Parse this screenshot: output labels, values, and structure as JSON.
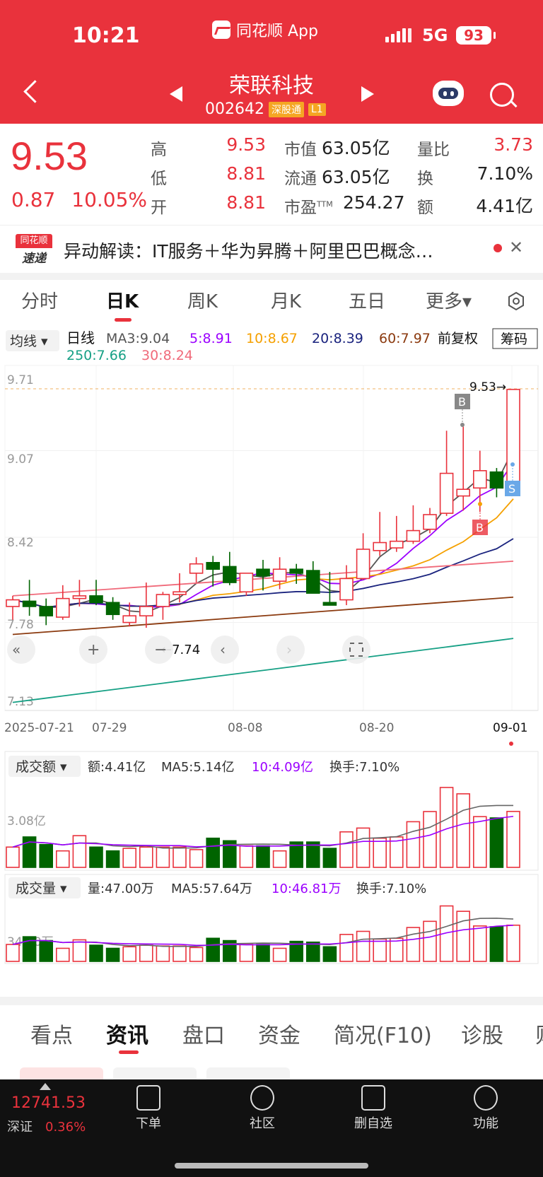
{
  "status": {
    "time": "10:21",
    "app": "同花顺 App",
    "network": "5G",
    "battery": "93"
  },
  "header": {
    "name": "荣联科技",
    "code": "002642",
    "badge1": "深股通",
    "badge2": "L1"
  },
  "quote": {
    "price": "9.53",
    "change": "0.87",
    "change_pct": "10.05%",
    "high_label": "高",
    "high": "9.53",
    "low_label": "低",
    "low": "8.81",
    "open_label": "开",
    "open": "8.81",
    "mcap_label": "市值",
    "mcap": "63.05亿",
    "float_label": "流通",
    "float": "63.05亿",
    "pe_label": "市盈",
    "pe_sup": "TTM",
    "pe": "254.27",
    "vr_label": "量比",
    "vr": "3.73",
    "turnover_label": "换",
    "turnover": "7.10%",
    "amount_label": "额",
    "amount": "4.41亿"
  },
  "news": {
    "logo_top": "同花顺",
    "logo_bottom": "速递",
    "text": "异动解读：IT服务＋华为昇腾＋阿里巴巴概念…",
    "close": "✕"
  },
  "tabs": [
    "分时",
    "日K",
    "周K",
    "月K",
    "五日",
    "更多▾"
  ],
  "chart": {
    "ma_button": "均线 ▾",
    "series_label": "日线",
    "ma3": "MA3:9.04",
    "ma5": "5:8.91",
    "ma10": "10:8.67",
    "ma20": "20:8.39",
    "ma60": "60:7.97",
    "ma250": "250:7.66",
    "ma30": "30:8.24",
    "adjust": "前复权",
    "chip_button": "筹码",
    "y_labels": [
      "9.71",
      "9.07",
      "8.42",
      "7.78",
      "7.13"
    ],
    "x_labels": [
      "2025-07-21",
      "07-29",
      "08-08",
      "08-20",
      "09-01"
    ],
    "max_label": "9.53→",
    "min_label": "←7.74",
    "marker_b": "B",
    "marker_s": "S",
    "colors": {
      "up": "#e9323c",
      "down": "#006400",
      "ma3": "#555555",
      "ma5": "#9b00ff",
      "ma10": "#f5a000",
      "ma20": "#1a237e",
      "ma60": "#8b3a0f",
      "ma250": "#16a085",
      "ma30": "#f06a7a"
    }
  },
  "chart_data": {
    "type": "candlestick",
    "x": [
      "07-21",
      "07-22",
      "07-23",
      "07-24",
      "07-25",
      "07-28",
      "07-29",
      "07-30",
      "07-31",
      "08-01",
      "08-04",
      "08-05",
      "08-06",
      "08-07",
      "08-08",
      "08-11",
      "08-12",
      "08-13",
      "08-14",
      "08-15",
      "08-18",
      "08-19",
      "08-20",
      "08-21",
      "08-22",
      "08-25",
      "08-26",
      "08-27",
      "08-28",
      "08-29",
      "09-01"
    ],
    "open": [
      7.9,
      7.94,
      7.9,
      7.82,
      7.96,
      7.98,
      7.93,
      7.78,
      7.83,
      7.9,
      7.99,
      8.15,
      8.23,
      8.2,
      8.01,
      8.18,
      8.09,
      8.18,
      8.17,
      7.93,
      7.95,
      8.11,
      8.32,
      8.34,
      8.39,
      8.48,
      8.6,
      8.73,
      8.79,
      8.91,
      8.81
    ],
    "high": [
      7.98,
      8.1,
      7.96,
      8.06,
      8.1,
      8.1,
      7.97,
      7.93,
      8.08,
      8.01,
      8.15,
      8.27,
      8.28,
      8.31,
      8.12,
      8.25,
      8.27,
      8.22,
      8.24,
      8.16,
      8.21,
      8.45,
      8.61,
      8.58,
      8.66,
      8.64,
      9.22,
      9.25,
      9.07,
      8.94,
      9.53
    ],
    "low": [
      7.8,
      7.83,
      7.76,
      7.8,
      7.9,
      7.91,
      7.8,
      7.75,
      7.74,
      7.8,
      7.93,
      8.08,
      8.05,
      8.06,
      7.98,
      8.02,
      8.03,
      8.07,
      8.09,
      7.92,
      7.91,
      8.1,
      8.28,
      8.31,
      8.37,
      8.45,
      8.58,
      8.62,
      8.61,
      8.72,
      8.81
    ],
    "close": [
      7.95,
      7.9,
      7.83,
      7.96,
      7.98,
      7.93,
      7.84,
      7.83,
      7.9,
      7.99,
      8.01,
      8.22,
      8.18,
      8.08,
      8.15,
      8.13,
      8.18,
      8.15,
      8.0,
      7.91,
      8.11,
      8.33,
      8.38,
      8.39,
      8.47,
      8.59,
      8.9,
      8.78,
      8.92,
      8.79,
      9.53
    ],
    "amount_yi": [
      1.6,
      2.4,
      1.8,
      1.3,
      2.5,
      1.6,
      1.3,
      1.5,
      1.6,
      1.6,
      1.6,
      1.4,
      2.3,
      2.1,
      1.7,
      1.7,
      1.3,
      2.0,
      2.0,
      1.5,
      2.8,
      3.1,
      2.3,
      2.4,
      3.6,
      4.4,
      6.3,
      5.8,
      4.0,
      3.9,
      4.41
    ],
    "volume_wan": [
      22,
      32,
      27,
      17,
      28,
      21,
      17,
      19,
      21,
      20,
      20,
      18,
      30,
      27,
      22,
      22,
      17,
      26,
      25,
      19,
      35,
      39,
      29,
      30,
      44,
      52,
      72,
      65,
      46,
      45,
      47.0
    ],
    "ylim": [
      7.13,
      9.71
    ]
  },
  "amount_panel": {
    "dropdown": "成交额 ▾",
    "value": "额:4.41亿",
    "ma5": "MA5:5.14亿",
    "ma10": "10:4.09亿",
    "turnover": "换手:7.10%",
    "y_label": "3.08亿"
  },
  "volume_panel": {
    "dropdown": "成交量 ▾",
    "value": "量:47.00万",
    "ma5": "MA5:57.64万",
    "ma10": "10:46.81万",
    "turnover": "换手:7.10%",
    "y_label": "34.80万"
  },
  "bottom_tabs": [
    "看点",
    "资讯",
    "盘口",
    "资金",
    "简况(F10)",
    "诊股",
    "则"
  ],
  "footer": {
    "index_value": "12741.53",
    "index_name": "深证",
    "index_pct": "0.36%",
    "items": [
      "下单",
      "社区",
      "删自选",
      "功能"
    ]
  }
}
